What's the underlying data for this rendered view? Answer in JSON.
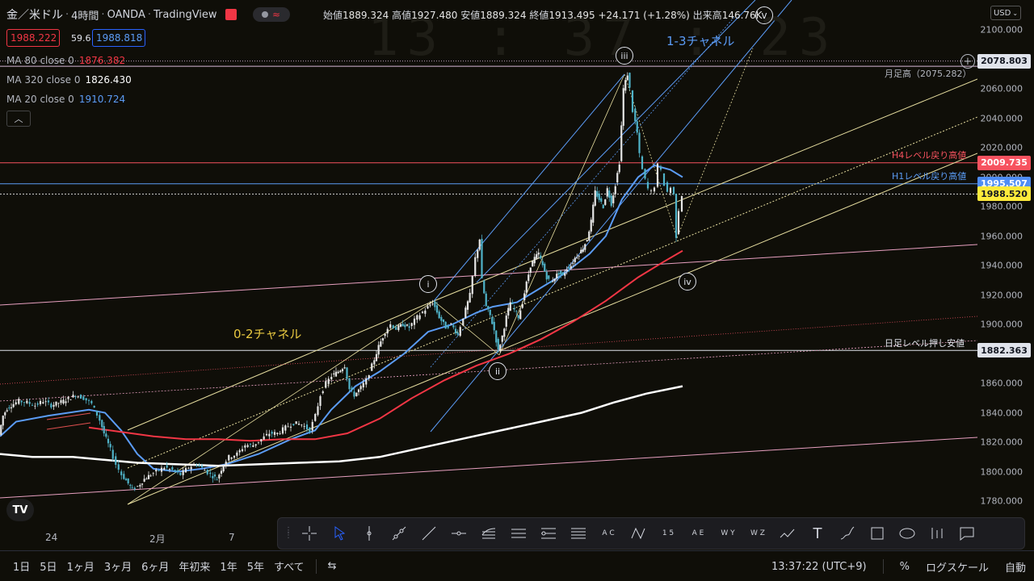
{
  "header": {
    "symbol": "金／米ドル",
    "timeframe": "4時間",
    "broker": "OANDA",
    "platform": "TradingView",
    "open_label": "始値",
    "open": "1889.324",
    "high_label": "高値",
    "high": "1927.480",
    "low_label": "安値",
    "low": "1889.324",
    "close_label": "終値",
    "close": "1913.495",
    "change": "+24.171 (+1.28%)",
    "volume_label": "出来高",
    "volume": "146.76K"
  },
  "quote": {
    "bid": "1988.222",
    "spread": "59.6",
    "ask": "1988.818"
  },
  "indicators": [
    {
      "label": "MA 80 close 0",
      "value": "1876.382",
      "color": "#f23645"
    },
    {
      "label": "MA 320 close 0",
      "value": "1826.430",
      "color": "#ffffff"
    },
    {
      "label": "MA 20 close 0",
      "value": "1910.724",
      "color": "#5b9cf6"
    }
  ],
  "clock_overlay": "13 : 37 : 23",
  "annotations": {
    "monthly_high": "月足高（2075.282）",
    "h4_level": "H4レベル戻り高値",
    "h1_level": "H1レベル戻り高値",
    "daily_level": "日足レベル押し安値",
    "channel_02": "0-2チャネル",
    "channel_13": "1-3チャネル",
    "wave_i": "i",
    "wave_ii": "ii",
    "wave_iii": "iii",
    "wave_iv": "iv",
    "wave_v": "v"
  },
  "price_axis": {
    "currency": "USD",
    "ticks": [
      "2100.000",
      "2080.000",
      "2060.000",
      "2040.000",
      "2020.000",
      "2000.000",
      "1980.000",
      "1960.000",
      "1940.000",
      "1920.000",
      "1900.000",
      "1880.000",
      "1860.000",
      "1840.000",
      "1820.000",
      "1800.000",
      "1780.000"
    ],
    "labels": [
      {
        "text": "2078.803",
        "price": 2078.803,
        "bg": "#e0e3eb",
        "fg": "#131722"
      },
      {
        "text": "2009.735",
        "price": 2009.735,
        "bg": "#f7525f",
        "fg": "#ffffff"
      },
      {
        "text": "1995.507",
        "price": 1995.507,
        "bg": "#4f8df5",
        "fg": "#ffffff"
      },
      {
        "text": "1988.520",
        "price": 1988.52,
        "bg": "#ffeb3b",
        "fg": "#131722"
      },
      {
        "text": "1882.363",
        "price": 1882.363,
        "bg": "#e0e3eb",
        "fg": "#131722"
      }
    ]
  },
  "time_axis": [
    "24",
    "2月",
    "7"
  ],
  "drawing_tools": [
    "crosshair-icon",
    "cursor-icon",
    "vertical-line-icon",
    "ray-icon",
    "trend-line-icon",
    "horizontal-ray-icon",
    "pitchfork-icon",
    "parallel-channel-icon",
    "regression-icon",
    "fib-channel-icon",
    "xabcd-icon",
    "cypher-icon",
    "elliott-impulse-icon",
    "elliott-correction-icon",
    "elliott-triangle-icon",
    "elliott-double-combo-icon",
    "path-icon",
    "text-icon",
    "brush-icon",
    "rectangle-icon",
    "ellipse-icon",
    "long-position-icon",
    "comment-icon"
  ],
  "elliott_labels": {
    "abc": "A C",
    "num15": "1 5",
    "ae": "A E",
    "wy": "W Y",
    "wz": "W Z"
  },
  "timeframes": [
    "1日",
    "5日",
    "1ヶ月",
    "3ヶ月",
    "6ヶ月",
    "年初来",
    "1年",
    "5年",
    "すべて"
  ],
  "status": {
    "time": "13:37:22 (UTC+9)",
    "percent": "%",
    "log": "ログスケール",
    "auto": "自動"
  },
  "chart_data": {
    "type": "candlestick",
    "title": "",
    "ylim": [
      1773,
      2110
    ],
    "y_axis_side": "right",
    "horizontal_levels": [
      2075.282,
      2009.735,
      1995.507,
      1988.52,
      1882.363
    ],
    "price_path": [
      [
        0,
        1825
      ],
      [
        5,
        1838
      ],
      [
        10,
        1843
      ],
      [
        18,
        1846
      ],
      [
        25,
        1848
      ],
      [
        35,
        1847
      ],
      [
        45,
        1845
      ],
      [
        55,
        1848
      ],
      [
        65,
        1845
      ],
      [
        80,
        1848
      ],
      [
        95,
        1852
      ],
      [
        105,
        1850
      ],
      [
        115,
        1846
      ],
      [
        125,
        1835
      ],
      [
        130,
        1826
      ],
      [
        138,
        1815
      ],
      [
        145,
        1805
      ],
      [
        152,
        1798
      ],
      [
        160,
        1792
      ],
      [
        165,
        1788
      ],
      [
        172,
        1790
      ],
      [
        180,
        1795
      ],
      [
        188,
        1798
      ],
      [
        195,
        1800
      ],
      [
        205,
        1803
      ],
      [
        215,
        1801
      ],
      [
        225,
        1798
      ],
      [
        235,
        1803
      ],
      [
        245,
        1805
      ],
      [
        255,
        1801
      ],
      [
        262,
        1798
      ],
      [
        270,
        1795
      ],
      [
        278,
        1805
      ],
      [
        285,
        1810
      ],
      [
        295,
        1812
      ],
      [
        305,
        1818
      ],
      [
        315,
        1818
      ],
      [
        325,
        1822
      ],
      [
        335,
        1826
      ],
      [
        345,
        1826
      ],
      [
        355,
        1830
      ],
      [
        365,
        1833
      ],
      [
        375,
        1832
      ],
      [
        385,
        1828
      ],
      [
        392,
        1838
      ],
      [
        398,
        1852
      ],
      [
        405,
        1860
      ],
      [
        412,
        1865
      ],
      [
        420,
        1868
      ],
      [
        428,
        1872
      ],
      [
        434,
        1856
      ],
      [
        440,
        1852
      ],
      [
        448,
        1857
      ],
      [
        455,
        1862
      ],
      [
        462,
        1872
      ],
      [
        470,
        1885
      ],
      [
        478,
        1895
      ],
      [
        485,
        1900
      ],
      [
        492,
        1897
      ],
      [
        500,
        1900
      ],
      [
        508,
        1898
      ],
      [
        518,
        1905
      ],
      [
        528,
        1910
      ],
      [
        537,
        1915
      ],
      [
        545,
        1905
      ],
      [
        553,
        1898
      ],
      [
        560,
        1900
      ],
      [
        568,
        1893
      ],
      [
        575,
        1905
      ],
      [
        583,
        1920
      ],
      [
        590,
        1945
      ],
      [
        595,
        1958
      ],
      [
        598,
        1930
      ],
      [
        603,
        1912
      ],
      [
        608,
        1906
      ],
      [
        613,
        1896
      ],
      [
        618,
        1882
      ],
      [
        623,
        1892
      ],
      [
        628,
        1905
      ],
      [
        633,
        1915
      ],
      [
        638,
        1910
      ],
      [
        643,
        1905
      ],
      [
        648,
        1915
      ],
      [
        653,
        1928
      ],
      [
        658,
        1940
      ],
      [
        663,
        1945
      ],
      [
        668,
        1948
      ],
      [
        673,
        1940
      ],
      [
        678,
        1932
      ],
      [
        683,
        1928
      ],
      [
        688,
        1932
      ],
      [
        693,
        1935
      ],
      [
        698,
        1933
      ],
      [
        703,
        1938
      ],
      [
        708,
        1940
      ],
      [
        713,
        1945
      ],
      [
        718,
        1948
      ],
      [
        723,
        1952
      ],
      [
        728,
        1958
      ],
      [
        733,
        1970
      ],
      [
        738,
        1990
      ],
      [
        743,
        1985
      ],
      [
        748,
        1980
      ],
      [
        753,
        1992
      ],
      [
        758,
        1982
      ],
      [
        763,
        1995
      ],
      [
        768,
        2010
      ],
      [
        773,
        2060
      ],
      [
        778,
        2070
      ],
      [
        781,
        2060
      ],
      [
        785,
        2045
      ],
      [
        790,
        2030
      ],
      [
        793,
        2015
      ],
      [
        797,
        2005
      ],
      [
        800,
        1998
      ],
      [
        804,
        1992
      ],
      [
        808,
        1990
      ],
      [
        812,
        1994
      ],
      [
        816,
        2008
      ],
      [
        820,
        2004
      ],
      [
        824,
        1995
      ],
      [
        828,
        1990
      ],
      [
        832,
        1993
      ],
      [
        836,
        1988
      ],
      [
        838,
        1960
      ],
      [
        842,
        1978
      ],
      [
        846,
        1988
      ]
    ],
    "moving_averages": [
      {
        "name": "MA 20",
        "color": "#5b9cf6",
        "path": [
          [
            0,
            1824
          ],
          [
            20,
            1834
          ],
          [
            60,
            1838
          ],
          [
            110,
            1842
          ],
          [
            130,
            1840
          ],
          [
            150,
            1828
          ],
          [
            170,
            1812
          ],
          [
            190,
            1802
          ],
          [
            220,
            1800
          ],
          [
            250,
            1802
          ],
          [
            280,
            1805
          ],
          [
            320,
            1812
          ],
          [
            360,
            1822
          ],
          [
            390,
            1828
          ],
          [
            410,
            1842
          ],
          [
            440,
            1858
          ],
          [
            470,
            1868
          ],
          [
            500,
            1880
          ],
          [
            530,
            1895
          ],
          [
            560,
            1900
          ],
          [
            590,
            1908
          ],
          [
            610,
            1912
          ],
          [
            640,
            1915
          ],
          [
            670,
            1925
          ],
          [
            700,
            1935
          ],
          [
            730,
            1948
          ],
          [
            750,
            1960
          ],
          [
            770,
            1985
          ],
          [
            790,
            2000
          ],
          [
            810,
            2008
          ],
          [
            830,
            2005
          ],
          [
            845,
            2000
          ]
        ]
      },
      {
        "name": "MA 80",
        "color": "#f23645",
        "path": [
          [
            110,
            1830
          ],
          [
            150,
            1827
          ],
          [
            190,
            1824
          ],
          [
            230,
            1822
          ],
          [
            270,
            1822
          ],
          [
            310,
            1821
          ],
          [
            350,
            1822
          ],
          [
            390,
            1822
          ],
          [
            430,
            1826
          ],
          [
            470,
            1836
          ],
          [
            510,
            1850
          ],
          [
            550,
            1862
          ],
          [
            590,
            1872
          ],
          [
            630,
            1880
          ],
          [
            670,
            1890
          ],
          [
            710,
            1902
          ],
          [
            750,
            1916
          ],
          [
            790,
            1932
          ],
          [
            820,
            1942
          ],
          [
            845,
            1950
          ]
        ]
      },
      {
        "name": "MA 320",
        "color": "#ffffff",
        "path": [
          [
            0,
            1812
          ],
          [
            40,
            1810
          ],
          [
            90,
            1810
          ],
          [
            130,
            1808
          ],
          [
            170,
            1806
          ],
          [
            220,
            1805
          ],
          [
            270,
            1804
          ],
          [
            320,
            1805
          ],
          [
            370,
            1806
          ],
          [
            420,
            1807
          ],
          [
            470,
            1810
          ],
          [
            520,
            1816
          ],
          [
            570,
            1822
          ],
          [
            620,
            1828
          ],
          [
            670,
            1834
          ],
          [
            720,
            1840
          ],
          [
            760,
            1847
          ],
          [
            800,
            1853
          ],
          [
            845,
            1858
          ]
        ]
      }
    ]
  }
}
